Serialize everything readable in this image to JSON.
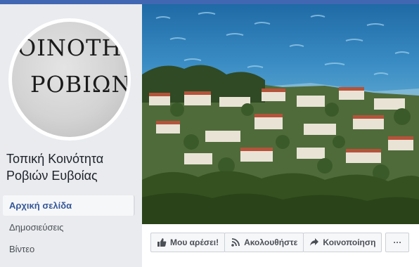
{
  "page": {
    "name": "Τοπική Κοινότητα Ροβιών Ευβοίας",
    "profile_seal": {
      "line1": "ΟΙΝΟΤΗ",
      "line2": "ΡΟΒΙΩΝ"
    }
  },
  "nav": {
    "items": [
      {
        "label": "Αρχική σελίδα",
        "active": true
      },
      {
        "label": "Δημοσιεύσεις",
        "active": false
      },
      {
        "label": "Βίντεο",
        "active": false
      }
    ]
  },
  "actions": {
    "like": "Μου αρέσει!",
    "follow": "Ακολουθήστε",
    "share": "Κοινοποίηση",
    "more": "···"
  },
  "colors": {
    "brand": "#4267b2",
    "link": "#365899",
    "sea": "#2b78b0"
  },
  "icons": [
    "like-icon",
    "follow-icon",
    "share-icon",
    "more-icon"
  ]
}
